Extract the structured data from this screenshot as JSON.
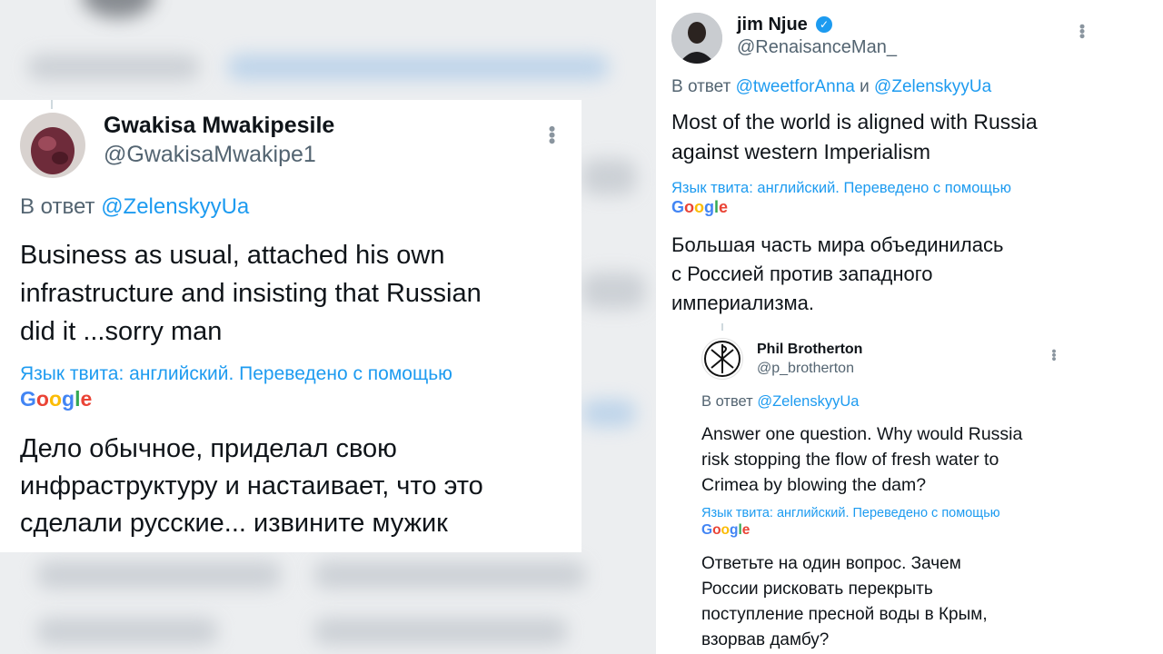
{
  "tweet_left": {
    "name": "Gwakisa Mwakipesile",
    "handle": "@GwakisaMwakipe1",
    "reply_prefix": "В ответ",
    "reply_mention": "@ZelenskyyUa",
    "text_lines": [
      "Business as usual, attached his own",
      "infrastructure and insisting that Russian",
      "did it ...sorry man"
    ],
    "translation_note": "Язык твита: английский. Переведено с помощью",
    "translation_lines": [
      "Дело обычное, приделал свою",
      "инфраструктуру и настаивает, что это",
      "сделали русские... извините мужик"
    ]
  },
  "tweet_right": {
    "name": "jim Njue",
    "handle": "@RenaisanceMan_",
    "reply_prefix": "В ответ",
    "reply_mention_1": "@tweetforAnna",
    "reply_conj": "и",
    "reply_mention_2": "@ZelenskyyUa",
    "text_lines": [
      "Most of the world is aligned with Russia",
      "against western Imperialism"
    ],
    "translation_note": "Язык твита: английский. Переведено с помощью",
    "translation_lines": [
      "Большая часть мира объединилась",
      "с Россией против западного",
      "империализма."
    ]
  },
  "tweet_nested": {
    "name": "Phil Brotherton",
    "handle": "@p_brotherton",
    "reply_prefix": "В ответ",
    "reply_mention": "@ZelenskyyUa",
    "text_lines": [
      "Answer one question. Why would Russia",
      "risk stopping the flow of fresh water to",
      "Crimea by blowing the dam?"
    ],
    "translation_note": "Язык твита: английский. Переведено с помощью",
    "translation_lines": [
      "Ответьте на один вопрос. Зачем",
      "России рисковать перекрыть",
      "поступление пресной воды в Крым,",
      "взорвав дамбу?"
    ]
  },
  "google_logo": [
    "G",
    "o",
    "o",
    "g",
    "l",
    "e"
  ],
  "colors": {
    "link": "#1d9bf0",
    "muted": "#536471",
    "text": "#0f1419",
    "google_blue": "#4285f4",
    "google_red": "#ea4335",
    "google_yellow": "#fbbc05",
    "google_green": "#34a853"
  },
  "icons": {
    "more": "more-vertical-icon",
    "verified": "verified-badge-icon"
  }
}
